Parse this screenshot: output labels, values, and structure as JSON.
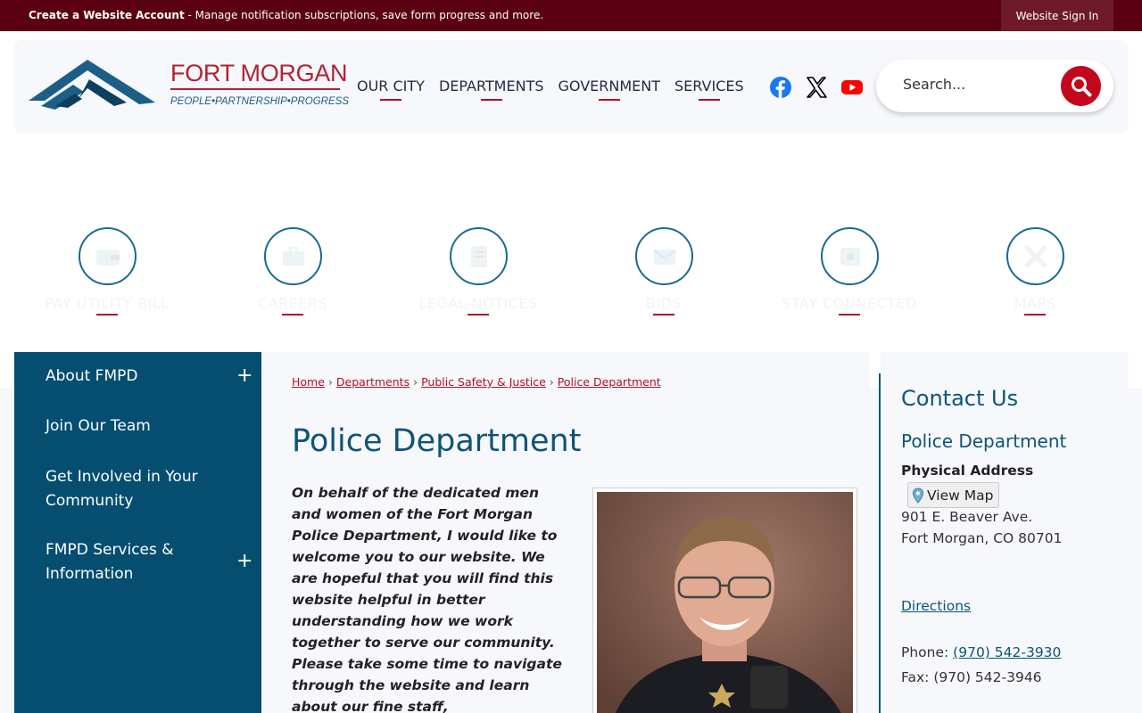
{
  "topbar": {
    "create_account": "Create a Website Account",
    "create_desc": " - Manage notification subscriptions, save form progress and more.",
    "sign_in": "Website Sign In"
  },
  "brand": {
    "name": "FORT MORGAN",
    "tagline": "PEOPLE•PARTNERSHIP•PROGRESS"
  },
  "nav": [
    "OUR CITY",
    "DEPARTMENTS",
    "GOVERNMENT",
    "SERVICES"
  ],
  "social": [
    {
      "icon": "facebook-icon",
      "color": "#1877f2"
    },
    {
      "icon": "x-icon",
      "color": "#000000"
    },
    {
      "icon": "youtube-icon",
      "color": "#ff0000"
    }
  ],
  "search": {
    "placeholder": "Search..."
  },
  "quick_links": [
    {
      "label": "PAY UTILITY BILL",
      "icon": "wallet-icon"
    },
    {
      "label": "CAREERS",
      "icon": "briefcase-icon"
    },
    {
      "label": "LEGAL NOTICES",
      "icon": "document-icon"
    },
    {
      "label": "BIDS",
      "icon": "envelope-icon"
    },
    {
      "label": "STAY CONNECTED",
      "icon": "bell-icon"
    },
    {
      "label": "MAPS",
      "icon": "map-pin-icon"
    }
  ],
  "sidebar": [
    {
      "label": "About FMPD",
      "expandable": true
    },
    {
      "label": "Join Our Team",
      "expandable": false
    },
    {
      "label": "Get Involved in Your Community",
      "expandable": false
    },
    {
      "label": "FMPD Services & Information",
      "expandable": true
    }
  ],
  "breadcrumb": [
    "Home",
    "Departments",
    "Public Safety & Justice",
    "Police Department"
  ],
  "page_title": "Police Department",
  "welcome_text": "On behalf of the dedicated men and women of the Fort Morgan Police Department, I would like to welcome you to our website.  We are hopeful that you will find this website helpful in better understanding how we work together to serve our community.  Please take some time to navigate through the website and learn about our fine staff,",
  "contact": {
    "heading": "Contact Us",
    "dept": "Police Department",
    "address_heading": "Physical Address",
    "view_map": "View Map",
    "street": "901 E. Beaver Ave.",
    "city": "Fort Morgan, CO 80701",
    "directions": "Directions",
    "phone_label": "Phone: ",
    "phone": "(970) 542-3930",
    "fax": "Fax: (970) 542-3946"
  },
  "colors": {
    "topbar": "#5a0012",
    "brand_red": "#b22233",
    "teal": "#0f5575",
    "sidebar": "#054e70"
  }
}
